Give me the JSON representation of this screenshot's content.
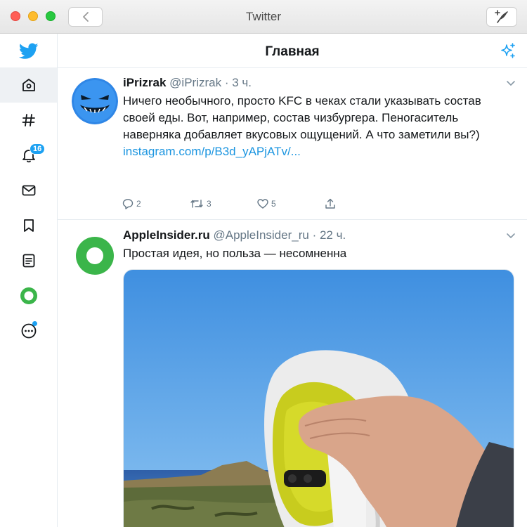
{
  "window": {
    "title": "Twitter"
  },
  "sidebar": {
    "items": [
      {
        "name": "home",
        "icon": "home-icon"
      },
      {
        "name": "explore",
        "icon": "hashtag-icon"
      },
      {
        "name": "notifications",
        "icon": "bell-icon",
        "badge": "16"
      },
      {
        "name": "messages",
        "icon": "mail-icon"
      },
      {
        "name": "bookmarks",
        "icon": "bookmark-icon"
      },
      {
        "name": "lists",
        "icon": "list-icon"
      },
      {
        "name": "profile",
        "icon": "avatar-icon"
      },
      {
        "name": "more",
        "icon": "more-icon"
      }
    ]
  },
  "main": {
    "title": "Главная",
    "tweets": [
      {
        "name": "iPrizrak",
        "handle": "@iPrizrak",
        "separator": "·",
        "time": "3 ч.",
        "text": "Ничего необычного, просто KFC в чеках стали указывать состав своей еды. Вот, например, состав чизбургера. Пеногаситель наверняка добавляет вкусовых ощущений. А что заметили вы?)",
        "link": "instagram.com/p/B3d_yAPjATv/...",
        "replies": "2",
        "retweets": "3",
        "likes": "5"
      },
      {
        "name": "AppleInsider.ru",
        "handle": "@AppleInsider_ru",
        "separator": "·",
        "time": "22 ч.",
        "text": "Простая идея, но польза — несомненна"
      }
    ]
  },
  "colors": {
    "accent": "#1da1f2",
    "link": "#1b95e0",
    "muted": "#657786"
  }
}
